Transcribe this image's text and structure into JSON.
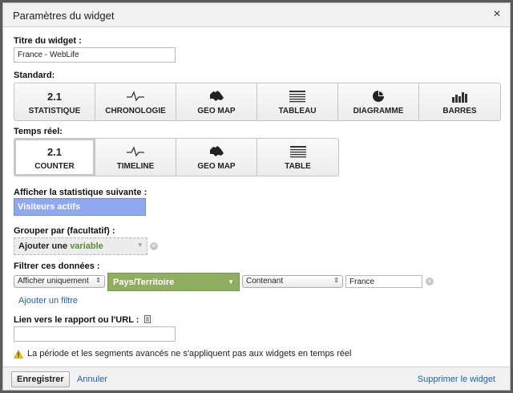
{
  "dialog": {
    "title": "Paramètres du widget",
    "close": "×"
  },
  "widget_title": {
    "label": "Titre du widget :",
    "value": "France - WebLife"
  },
  "standard": {
    "label": "Standard:",
    "options": [
      {
        "label": "STATISTIQUE",
        "number": "2.1",
        "icon": "number-icon"
      },
      {
        "label": "CHRONOLOGIE",
        "icon": "timeline-icon"
      },
      {
        "label": "GEO MAP",
        "icon": "australia-map-icon"
      },
      {
        "label": "TABLEAU",
        "icon": "table-icon"
      },
      {
        "label": "DIAGRAMME",
        "icon": "pie-chart-icon"
      },
      {
        "label": "BARRES",
        "icon": "bar-chart-icon"
      }
    ]
  },
  "realtime": {
    "label": "Temps réel:",
    "options": [
      {
        "label": "COUNTER",
        "number": "2.1",
        "icon": "number-icon",
        "selected": true
      },
      {
        "label": "TIMELINE",
        "icon": "timeline-icon"
      },
      {
        "label": "GEO MAP",
        "icon": "australia-map-icon"
      },
      {
        "label": "TABLE",
        "icon": "table-icon"
      }
    ]
  },
  "metric": {
    "label": "Afficher la statistique suivante :",
    "value": "Visiteurs actifs"
  },
  "group": {
    "label": "Grouper par (facultatif) :",
    "placeholder_prefix": "Ajouter une",
    "placeholder_highlight": "variable"
  },
  "filter": {
    "label": "Filtrer ces données :",
    "mode": "Afficher uniquement",
    "dimension": "Pays/Territoire",
    "operator": "Contenant",
    "value": "France",
    "add_filter": "Ajouter un filtre"
  },
  "link": {
    "label": "Lien vers le rapport ou l'URL :",
    "value": ""
  },
  "notice": "La période et les segments avancés ne s'appliquent pas aux widgets en temps réel",
  "footer": {
    "save": "Enregistrer",
    "cancel": "Annuler",
    "delete": "Supprimer le widget"
  },
  "colors": {
    "metric_bg": "#8fa8f0",
    "dimension_bg": "#8fae62",
    "link": "#1f5fb8",
    "warning": "#f2c200"
  }
}
